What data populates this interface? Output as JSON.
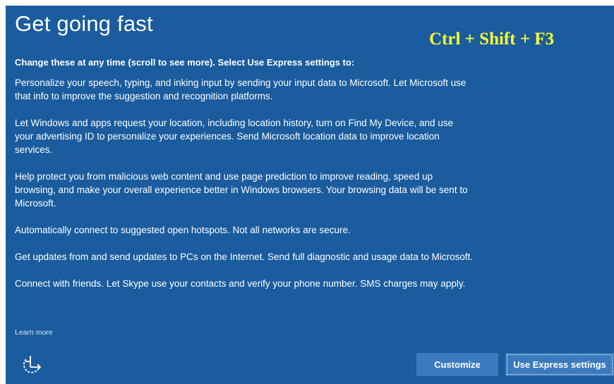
{
  "page": {
    "title": "Get going fast",
    "overlay_text": "Ctrl + Shift + F3",
    "subheading": "Change these at any time (scroll to see more). Select Use Express settings to:"
  },
  "paragraphs": [
    "Personalize your speech, typing, and inking input by sending your input data to Microsoft. Let Microsoft use that info to improve the suggestion and recognition platforms.",
    "Let Windows and apps request your location, including location history, turn on Find My Device, and use your advertising ID to personalize your experiences. Send Microsoft location data to improve location services.",
    "Help protect you from malicious web content and use page prediction to improve reading, speed up browsing, and make your overall experience better in Windows browsers. Your browsing data will be sent to Microsoft.",
    "Automatically connect to suggested open hotspots. Not all networks are secure.",
    "Get updates from and send updates to PCs on the Internet. Send full diagnostic and usage data to Microsoft.",
    "Connect with friends. Let Skype use your contacts and verify your phone number. SMS charges may apply."
  ],
  "footer": {
    "learn_more": "Learn more",
    "customize_label": "Customize",
    "express_label": "Use Express settings",
    "accessibility_icon": "ease-of-access-icon"
  },
  "colors": {
    "background": "#1a5c9e",
    "button": "#3b7abf",
    "overlay_text": "#ffff33"
  }
}
